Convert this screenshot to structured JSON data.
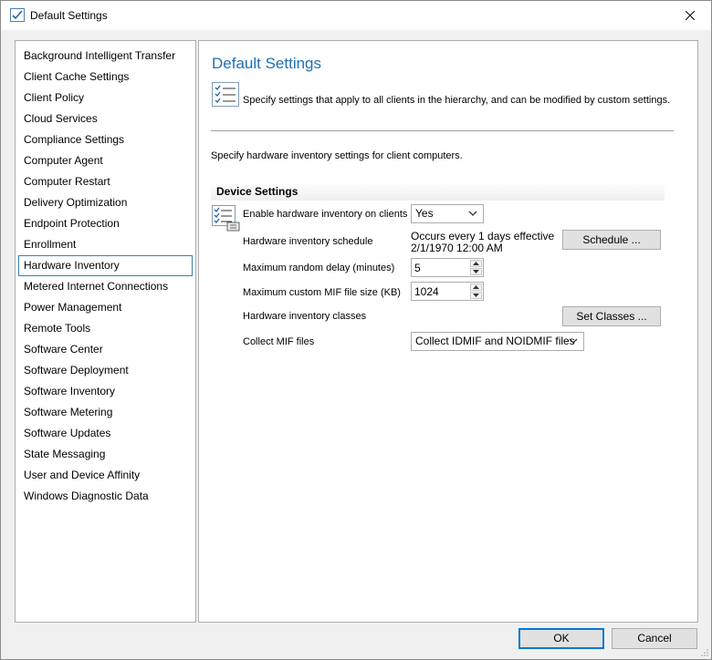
{
  "window": {
    "title": "Default Settings"
  },
  "nav": {
    "items": [
      {
        "label": "Background Intelligent Transfer"
      },
      {
        "label": "Client Cache Settings"
      },
      {
        "label": "Client Policy"
      },
      {
        "label": "Cloud Services"
      },
      {
        "label": "Compliance Settings"
      },
      {
        "label": "Computer Agent"
      },
      {
        "label": "Computer Restart"
      },
      {
        "label": "Delivery Optimization"
      },
      {
        "label": "Endpoint Protection"
      },
      {
        "label": "Enrollment"
      },
      {
        "label": "Hardware Inventory"
      },
      {
        "label": "Metered Internet Connections"
      },
      {
        "label": "Power Management"
      },
      {
        "label": "Remote Tools"
      },
      {
        "label": "Software Center"
      },
      {
        "label": "Software Deployment"
      },
      {
        "label": "Software Inventory"
      },
      {
        "label": "Software Metering"
      },
      {
        "label": "Software Updates"
      },
      {
        "label": "State Messaging"
      },
      {
        "label": "User and Device Affinity"
      },
      {
        "label": "Windows Diagnostic Data"
      }
    ],
    "selected": "Hardware Inventory"
  },
  "content": {
    "title": "Default Settings",
    "header_desc": "Specify settings that apply to all clients in the hierarchy, and can be modified by custom settings.",
    "section_desc": "Specify hardware inventory settings for client computers.",
    "group_title": "Device Settings",
    "enable_label": "Enable hardware inventory on clients",
    "enable_value": "Yes",
    "schedule_label": "Hardware inventory schedule",
    "schedule_line1": "Occurs every 1 days effective",
    "schedule_line2": "2/1/1970 12:00 AM",
    "schedule_button": "Schedule ...",
    "delay_label": "Maximum random delay (minutes)",
    "delay_value": "5",
    "mif_size_label": "Maximum custom MIF file size (KB)",
    "mif_size_value": "1024",
    "classes_label": "Hardware inventory classes",
    "classes_button": "Set Classes ...",
    "collect_label": "Collect MIF files",
    "collect_value": "Collect IDMIF and NOIDMIF files"
  },
  "footer": {
    "ok": "OK",
    "cancel": "Cancel"
  },
  "colors": {
    "accent": "#0078d7",
    "title_blue": "#1f6fb5",
    "selection_border": "#3c7fb1"
  },
  "icons": {
    "title": "checklist-icon",
    "close": "close-icon",
    "header": "settings-list-icon",
    "row": "settings-list-icon",
    "dropdown": "chevron-down-icon",
    "spin_up": "spin-up-icon",
    "spin_down": "spin-down-icon"
  }
}
